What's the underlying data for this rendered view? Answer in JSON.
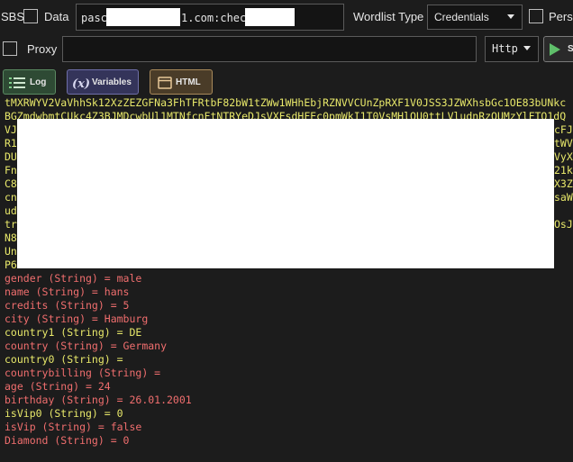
{
  "toolbar": {
    "sbs_label": "SBS",
    "data_label": "Data",
    "data_input_prefix": "pasc",
    "data_input_middle": "1.com:chec",
    "wordlist_type_label": "Wordlist Type",
    "wordlist_type_value": "Credentials",
    "persist_label": "Persis",
    "proxy_label": "Proxy",
    "proxy_input_value": "",
    "proxy_type_value": "Http",
    "run_label": "S"
  },
  "tabs": {
    "log_label": "Log",
    "variables_label": "Variables",
    "html_label": "HTML"
  },
  "console": {
    "top_lines": [
      "tMXRWYV2VaVhhSk12XzZEZGFNa3FhTFRtbF82bW1tZWw1WHhEbjRZNVVCUnZpRXF1V0JSS3JZWXhsbGc1OE83bUNkc",
      "BGZmdwbmtCUkc4Z3BJMDcwbUl1MTNfcnFtNTRYeDJsVXFsdHFEc0pmWkI1T0VsMHlQU0ttLVludnRzOUMzYlFTQ1dQ",
      "VJ",
      "R1",
      "DU",
      "Fn",
      "C8",
      "cn",
      "ud",
      "tr",
      "N8",
      "Un",
      "P6"
    ],
    "right_fragments": [
      "",
      "",
      "cFJ",
      "tWV",
      "VyX",
      "21k",
      "X3Z",
      "saW",
      "",
      "OsJ",
      "",
      "",
      ""
    ],
    "variables": [
      {
        "text": "gender (String) = male",
        "color": "red"
      },
      {
        "text": "name (String) = hans",
        "color": "red"
      },
      {
        "text": "credits (String) = 5",
        "color": "red"
      },
      {
        "text": "city (String) = Hamburg",
        "color": "red"
      },
      {
        "text": "country1 (String) = DE",
        "color": "yellow"
      },
      {
        "text": "country (String) = Germany",
        "color": "red"
      },
      {
        "text": "country0 (String) =",
        "color": "yellow"
      },
      {
        "text": "countrybilling (String) =",
        "color": "red"
      },
      {
        "text": "age (String) = 24",
        "color": "red"
      },
      {
        "text": "birthday (String) = 26.01.2001",
        "color": "red"
      },
      {
        "text": "isVip0 (String) = 0",
        "color": "yellow"
      },
      {
        "text": "isVip (String) = false",
        "color": "red"
      },
      {
        "text": "Diamond (String) = 0",
        "color": "red"
      }
    ]
  },
  "colors": {
    "background": "#1c1c1c",
    "log_yellow": "#e8e86a",
    "log_red": "#f06e6e",
    "redaction": "#ffffff"
  },
  "icons": {
    "log": "list-icon",
    "variables": "function-icon",
    "html": "window-icon",
    "run": "play-icon"
  }
}
